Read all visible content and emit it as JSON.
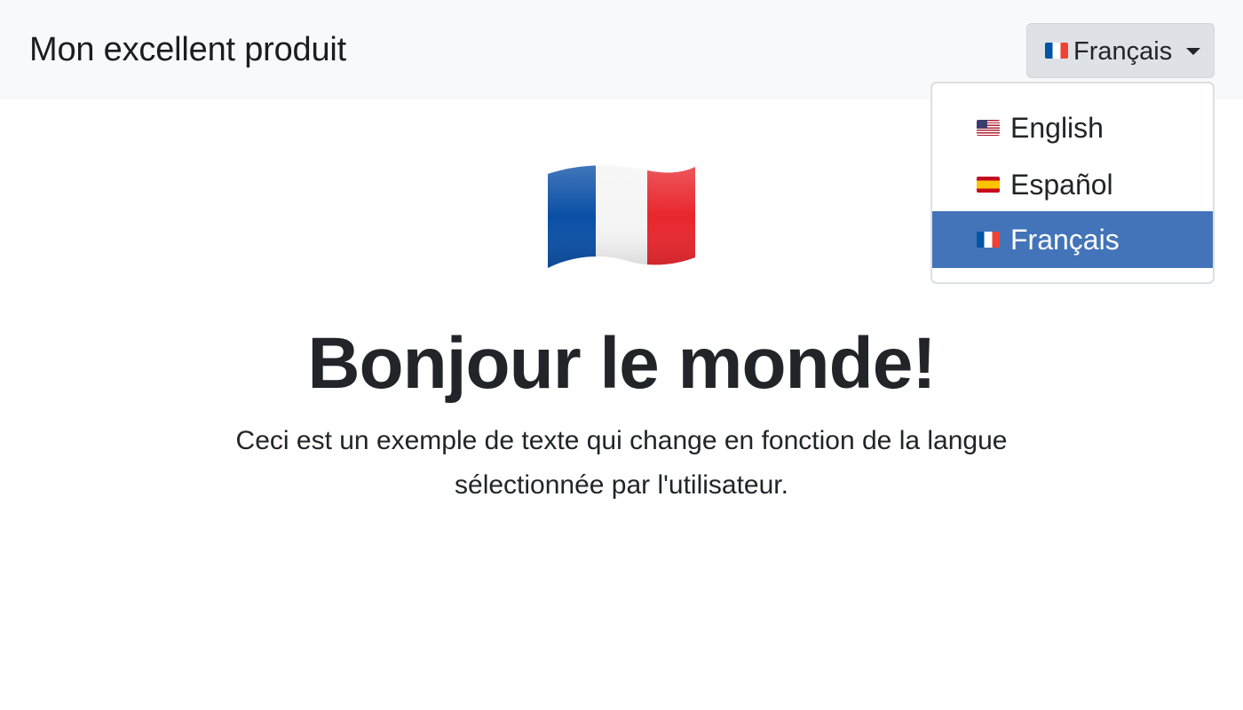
{
  "navbar": {
    "brand": "Mon excellent produit",
    "language_toggle": {
      "label": "Français",
      "flag_icon": "flag-france-icon"
    }
  },
  "language_menu": {
    "items": [
      {
        "label": "English",
        "flag_icon": "flag-usa-icon",
        "active": false
      },
      {
        "label": "Español",
        "flag_icon": "flag-spain-icon",
        "active": false
      },
      {
        "label": "Français",
        "flag_icon": "flag-france-icon",
        "active": true
      }
    ]
  },
  "hero": {
    "flag_icon": "flag-france-icon",
    "title": "Bonjour le monde!",
    "text": "Ceci est un exemple de texte qui change en fonction de la langue sélectionnée par l'utilisateur."
  },
  "colors": {
    "navbar_bg": "#f8f9fa",
    "toggle_bg": "#dee2e6",
    "active_item_bg": "#4374b9",
    "text": "#212529"
  }
}
